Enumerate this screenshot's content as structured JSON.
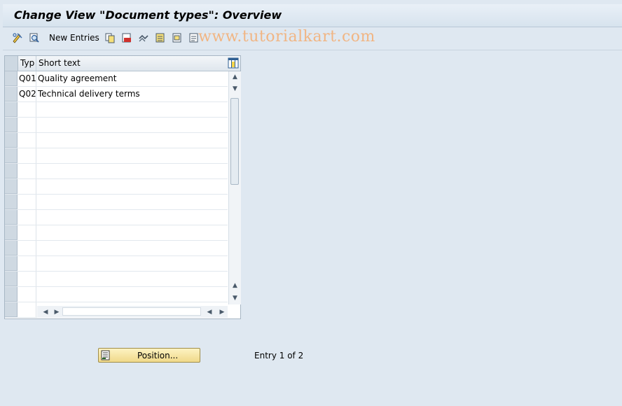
{
  "title": "Change View \"Document types\": Overview",
  "toolbar": {
    "new_entries_label": "New Entries",
    "icons": [
      "display-change-icon",
      "display-details-icon",
      "copy-icon",
      "delete-icon",
      "undo-change-icon",
      "select-all-icon",
      "select-block-icon",
      "deselect-all-icon"
    ]
  },
  "watermark": "www.tutorialkart.com",
  "table": {
    "columns": [
      "Typ",
      "Short text"
    ],
    "rows": [
      {
        "typ": "Q01",
        "short": "Quality agreement"
      },
      {
        "typ": "Q02",
        "short": "Technical delivery terms"
      }
    ]
  },
  "footer": {
    "position_label": "Position...",
    "entry_text": "Entry 1 of 2"
  },
  "colors": {
    "background": "#dfe8f1",
    "watermark": "#f2b37e",
    "button_yellow": "#f0d98a"
  }
}
